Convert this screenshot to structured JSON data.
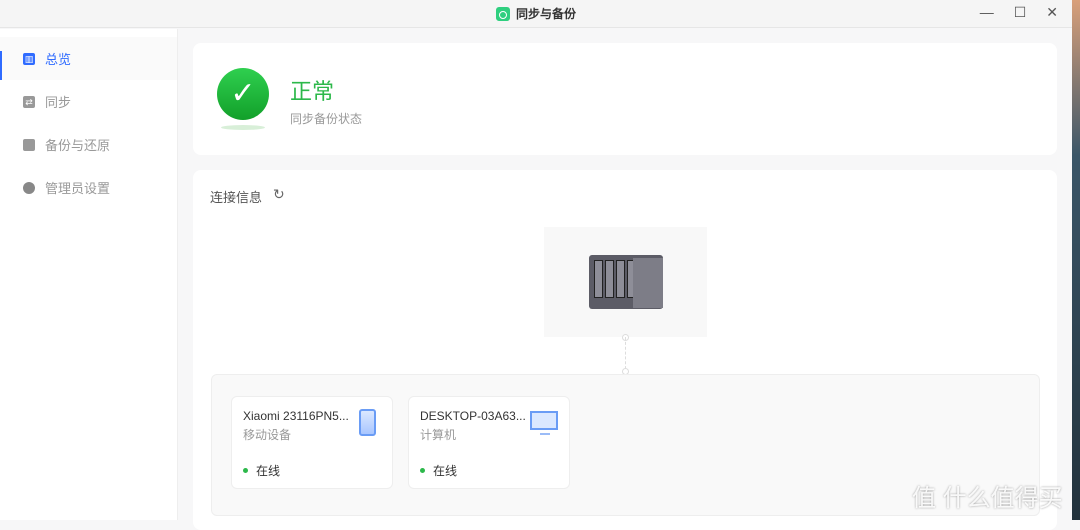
{
  "window": {
    "title": "同步与备份"
  },
  "sidebar": {
    "items": [
      {
        "label": "总览"
      },
      {
        "label": "同步"
      },
      {
        "label": "备份与还原"
      },
      {
        "label": "管理员设置"
      }
    ]
  },
  "status": {
    "title": "正常",
    "subtitle": "同步备份状态"
  },
  "connection": {
    "title": "连接信息",
    "devices": [
      {
        "name": "Xiaomi 23116PN5...",
        "type": "移动设备",
        "status": "在线"
      },
      {
        "name": "DESKTOP-03A63...",
        "type": "计算机",
        "status": "在线"
      }
    ]
  },
  "watermark": "值 什么值得买"
}
